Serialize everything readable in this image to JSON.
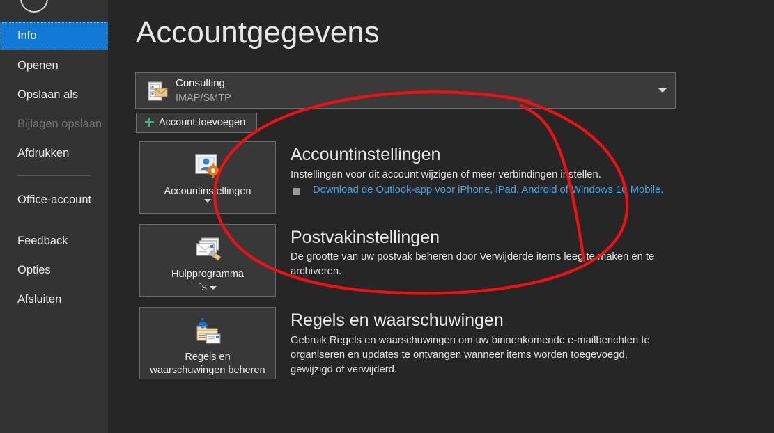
{
  "sidebar": {
    "back_button": "back-circle",
    "items": [
      {
        "label": "Info",
        "state": "selected"
      },
      {
        "label": "Openen",
        "state": "normal"
      },
      {
        "label": "Opslaan als",
        "state": "normal"
      },
      {
        "label": "Bijlagen opslaan",
        "state": "disabled"
      },
      {
        "label": "Afdrukken",
        "state": "normal"
      },
      {
        "label": "Office-account",
        "state": "normal"
      },
      {
        "label": "Feedback",
        "state": "normal"
      },
      {
        "label": "Opties",
        "state": "normal"
      },
      {
        "label": "Afsluiten",
        "state": "normal"
      }
    ]
  },
  "main": {
    "title": "Accountgegevens",
    "account": {
      "name": "Consulting",
      "type": "IMAP/SMTP",
      "icon": "mail-account-icon",
      "chevron": "chevron-down-icon"
    },
    "add_account": {
      "label": "Account toevoegen",
      "icon": "plus-icon"
    },
    "sections": [
      {
        "tile_label": "Accountinstellingen",
        "tile_icon": "account-settings-icon",
        "tile_caret": true,
        "heading": "Accountinstellingen",
        "description": "Instellingen voor dit account wijzigen of meer verbindingen instellen.",
        "link": "Download de Outlook-app voor iPhone, iPad, Android of Windows 10 Mobile."
      },
      {
        "tile_label_line1": "Hulpprogramma",
        "tile_label_line2": "´s",
        "tile_icon": "mailbox-cleanup-icon",
        "tile_caret": true,
        "heading": "Postvakinstellingen",
        "description": "De grootte van uw postvak beheren door Verwijderde items leeg te maken en te archiveren."
      },
      {
        "tile_label_line1": "Regels en",
        "tile_label_line2": "waarschuwingen beheren",
        "tile_icon": "rules-alerts-icon",
        "tile_caret": false,
        "heading": "Regels en waarschuwingen",
        "description": "Gebruik Regels en waarschuwingen om uw binnenkomende e-mailberichten te organiseren en updates te ontvangen wanneer items worden toegevoegd, gewijzigd of verwijderd."
      }
    ]
  },
  "annotation": {
    "type": "freehand-ellipse",
    "color": "#ee1111"
  },
  "colors": {
    "accent_selected": "#0f7ad6",
    "sidebar_bg": "#333333",
    "content_bg": "#262626",
    "tile_bg": "#383838",
    "link": "#4ea3e0",
    "plus_green": "#4faa7d",
    "annotation_red": "#ee1111"
  }
}
